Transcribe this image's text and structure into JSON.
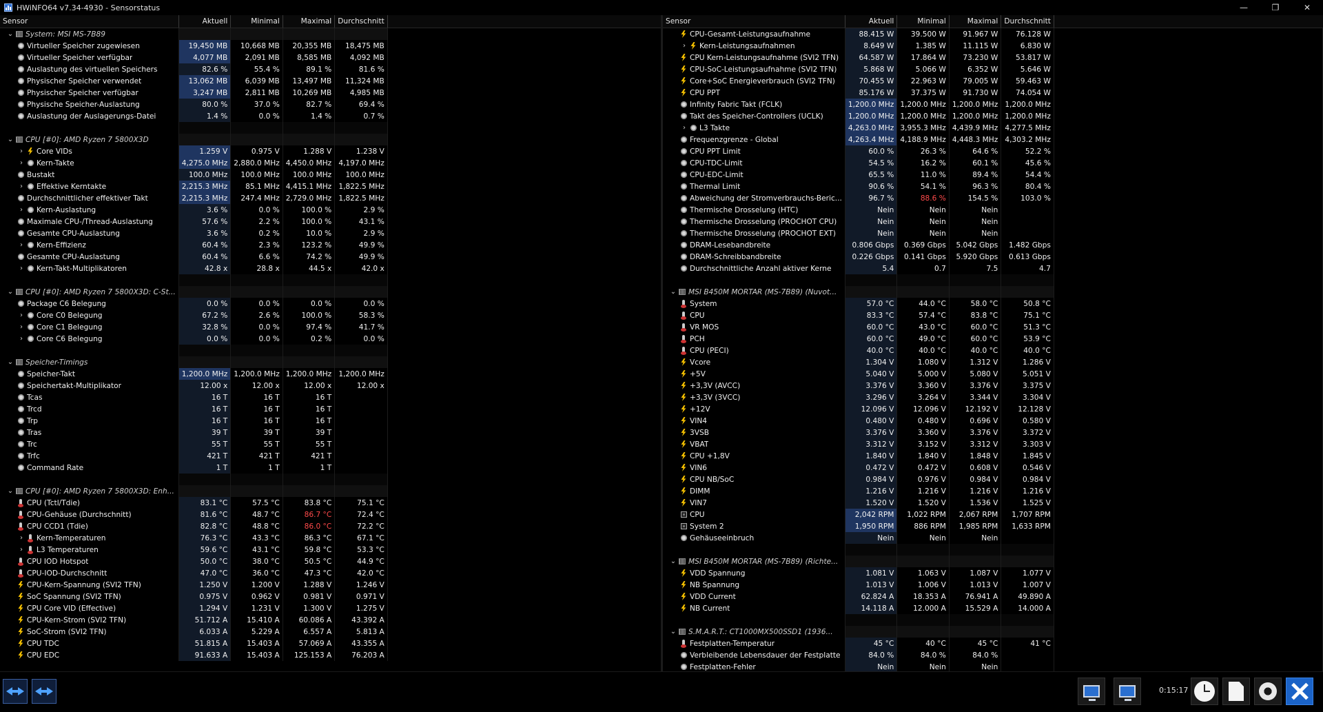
{
  "window": {
    "title": "HWiNFO64 v7.34-4930 - Sensorstatus",
    "controls": [
      "—",
      "❐",
      "✕"
    ]
  },
  "columns": {
    "sensor": "Sensor",
    "current": "Aktuell",
    "min": "Minimal",
    "max": "Maximal",
    "avg": "Durchschnitt"
  },
  "left": [
    {
      "t": "g",
      "n": "System: MSI MS-7B89"
    },
    {
      "t": "r",
      "i": "clock",
      "l": 1,
      "n": "Virtueller Speicher zugewiesen",
      "c": "19,450 MB",
      "mi": "10,668 MB",
      "ma": "20,355 MB",
      "av": "18,475 MB",
      "h": 1
    },
    {
      "t": "r",
      "i": "clock",
      "l": 1,
      "n": "Virtueller Speicher verfügbar",
      "c": "4,077 MB",
      "mi": "2,091 MB",
      "ma": "8,585 MB",
      "av": "4,092 MB",
      "h": 1
    },
    {
      "t": "r",
      "i": "clock",
      "l": 1,
      "n": "Auslastung des virtuellen Speichers",
      "c": "82.6 %",
      "mi": "55.4 %",
      "ma": "89.1 %",
      "av": "81.6 %"
    },
    {
      "t": "r",
      "i": "clock",
      "l": 1,
      "n": "Physischer Speicher verwendet",
      "c": "13,062 MB",
      "mi": "6,039 MB",
      "ma": "13,497 MB",
      "av": "11,324 MB",
      "h": 1
    },
    {
      "t": "r",
      "i": "clock",
      "l": 1,
      "n": "Physischer Speicher verfügbar",
      "c": "3,247 MB",
      "mi": "2,811 MB",
      "ma": "10,269 MB",
      "av": "4,985 MB",
      "h": 1
    },
    {
      "t": "r",
      "i": "clock",
      "l": 1,
      "n": "Physische Speicher-Auslastung",
      "c": "80.0 %",
      "mi": "37.0 %",
      "ma": "82.7 %",
      "av": "69.4 %"
    },
    {
      "t": "r",
      "i": "clock",
      "l": 1,
      "n": "Auslastung der Auslagerungs-Datei",
      "c": "1.4 %",
      "mi": "0.0 %",
      "ma": "1.4 %",
      "av": "0.7 %"
    },
    {
      "t": "s"
    },
    {
      "t": "g",
      "n": "CPU [#0]: AMD Ryzen 7 5800X3D"
    },
    {
      "t": "r",
      "i": "bolt",
      "l": 2,
      "x": 1,
      "n": "Core VIDs",
      "c": "1.259 V",
      "mi": "0.975 V",
      "ma": "1.288 V",
      "av": "1.238 V",
      "h": 1
    },
    {
      "t": "r",
      "i": "clock",
      "l": 2,
      "x": 1,
      "n": "Kern-Takte",
      "c": "4,275.0 MHz",
      "mi": "2,880.0 MHz",
      "ma": "4,450.0 MHz",
      "av": "4,197.0 MHz",
      "h": 1
    },
    {
      "t": "r",
      "i": "clock",
      "l": 1,
      "n": "Bustakt",
      "c": "100.0 MHz",
      "mi": "100.0 MHz",
      "ma": "100.0 MHz",
      "av": "100.0 MHz"
    },
    {
      "t": "r",
      "i": "clock",
      "l": 2,
      "x": 1,
      "n": "Effektive Kerntakte",
      "c": "2,215.3 MHz",
      "mi": "85.1 MHz",
      "ma": "4,415.1 MHz",
      "av": "1,822.5 MHz",
      "h": 1
    },
    {
      "t": "r",
      "i": "clock",
      "l": 1,
      "n": "Durchschnittlicher effektiver Takt",
      "c": "2,215.3 MHz",
      "mi": "247.4 MHz",
      "ma": "2,729.0 MHz",
      "av": "1,822.5 MHz",
      "h": 1
    },
    {
      "t": "r",
      "i": "clock",
      "l": 2,
      "x": 1,
      "n": "Kern-Auslastung",
      "c": "3.6 %",
      "mi": "0.0 %",
      "ma": "100.0 %",
      "av": "2.9 %"
    },
    {
      "t": "r",
      "i": "clock",
      "l": 1,
      "n": "Maximale CPU-/Thread-Auslastung",
      "c": "57.6 %",
      "mi": "2.2 %",
      "ma": "100.0 %",
      "av": "43.1 %"
    },
    {
      "t": "r",
      "i": "clock",
      "l": 1,
      "n": "Gesamte CPU-Auslastung",
      "c": "3.6 %",
      "mi": "0.2 %",
      "ma": "10.0 %",
      "av": "2.9 %"
    },
    {
      "t": "r",
      "i": "clock",
      "l": 2,
      "x": 1,
      "n": "Kern-Effizienz",
      "c": "60.4 %",
      "mi": "2.3 %",
      "ma": "123.2 %",
      "av": "49.9 %"
    },
    {
      "t": "r",
      "i": "clock",
      "l": 1,
      "n": "Gesamte CPU-Auslastung",
      "c": "60.4 %",
      "mi": "6.6 %",
      "ma": "74.2 %",
      "av": "49.9 %"
    },
    {
      "t": "r",
      "i": "clock",
      "l": 2,
      "x": 1,
      "n": "Kern-Takt-Multiplikatoren",
      "c": "42.8 x",
      "mi": "28.8 x",
      "ma": "44.5 x",
      "av": "42.0 x"
    },
    {
      "t": "s"
    },
    {
      "t": "g",
      "n": "CPU [#0]: AMD Ryzen 7 5800X3D: C-St..."
    },
    {
      "t": "r",
      "i": "clock",
      "l": 1,
      "n": "Package C6 Belegung",
      "c": "0.0 %",
      "mi": "0.0 %",
      "ma": "0.0 %",
      "av": "0.0 %"
    },
    {
      "t": "r",
      "i": "clock",
      "l": 2,
      "x": 1,
      "n": "Core C0 Belegung",
      "c": "67.2 %",
      "mi": "2.6 %",
      "ma": "100.0 %",
      "av": "58.3 %"
    },
    {
      "t": "r",
      "i": "clock",
      "l": 2,
      "x": 1,
      "n": "Core C1 Belegung",
      "c": "32.8 %",
      "mi": "0.0 %",
      "ma": "97.4 %",
      "av": "41.7 %"
    },
    {
      "t": "r",
      "i": "clock",
      "l": 2,
      "x": 1,
      "n": "Core C6 Belegung",
      "c": "0.0 %",
      "mi": "0.0 %",
      "ma": "0.2 %",
      "av": "0.0 %"
    },
    {
      "t": "s"
    },
    {
      "t": "g",
      "n": "Speicher-Timings"
    },
    {
      "t": "r",
      "i": "clock",
      "l": 1,
      "n": "Speicher-Takt",
      "c": "1,200.0 MHz",
      "mi": "1,200.0 MHz",
      "ma": "1,200.0 MHz",
      "av": "1,200.0 MHz",
      "h": 1
    },
    {
      "t": "r",
      "i": "clock",
      "l": 1,
      "n": "Speichertakt-Multiplikator",
      "c": "12.00 x",
      "mi": "12.00 x",
      "ma": "12.00 x",
      "av": "12.00 x"
    },
    {
      "t": "r",
      "i": "clock",
      "l": 1,
      "n": "Tcas",
      "c": "16 T",
      "mi": "16 T",
      "ma": "16 T",
      "av": ""
    },
    {
      "t": "r",
      "i": "clock",
      "l": 1,
      "n": "Trcd",
      "c": "16 T",
      "mi": "16 T",
      "ma": "16 T",
      "av": ""
    },
    {
      "t": "r",
      "i": "clock",
      "l": 1,
      "n": "Trp",
      "c": "16 T",
      "mi": "16 T",
      "ma": "16 T",
      "av": ""
    },
    {
      "t": "r",
      "i": "clock",
      "l": 1,
      "n": "Tras",
      "c": "39 T",
      "mi": "39 T",
      "ma": "39 T",
      "av": ""
    },
    {
      "t": "r",
      "i": "clock",
      "l": 1,
      "n": "Trc",
      "c": "55 T",
      "mi": "55 T",
      "ma": "55 T",
      "av": ""
    },
    {
      "t": "r",
      "i": "clock",
      "l": 1,
      "n": "Trfc",
      "c": "421 T",
      "mi": "421 T",
      "ma": "421 T",
      "av": ""
    },
    {
      "t": "r",
      "i": "clock",
      "l": 1,
      "n": "Command Rate",
      "c": "1 T",
      "mi": "1 T",
      "ma": "1 T",
      "av": ""
    },
    {
      "t": "s"
    },
    {
      "t": "g",
      "n": "CPU [#0]: AMD Ryzen 7 5800X3D: Enh..."
    },
    {
      "t": "r",
      "i": "therm",
      "l": 1,
      "n": "CPU (Tctl/Tdie)",
      "c": "83.1 °C",
      "mi": "57.5 °C",
      "ma": "83.8 °C",
      "av": "75.1 °C"
    },
    {
      "t": "r",
      "i": "therm",
      "l": 1,
      "n": "CPU-Gehäuse (Durchschnitt)",
      "c": "81.6 °C",
      "mi": "48.7 °C",
      "ma": "86.7 °C",
      "av": "72.4 °C",
      "rm": 1
    },
    {
      "t": "r",
      "i": "therm",
      "l": 1,
      "n": "CPU CCD1 (Tdie)",
      "c": "82.8 °C",
      "mi": "48.8 °C",
      "ma": "86.0 °C",
      "av": "72.2 °C",
      "rm": 1
    },
    {
      "t": "r",
      "i": "therm",
      "l": 2,
      "x": 1,
      "n": "Kern-Temperaturen",
      "c": "76.3 °C",
      "mi": "43.3 °C",
      "ma": "86.3 °C",
      "av": "67.1 °C"
    },
    {
      "t": "r",
      "i": "therm",
      "l": 2,
      "x": 1,
      "n": "L3 Temperaturen",
      "c": "59.6 °C",
      "mi": "43.1 °C",
      "ma": "59.8 °C",
      "av": "53.3 °C"
    },
    {
      "t": "r",
      "i": "therm",
      "l": 1,
      "n": "CPU IOD Hotspot",
      "c": "50.0 °C",
      "mi": "38.0 °C",
      "ma": "50.5 °C",
      "av": "44.9 °C"
    },
    {
      "t": "r",
      "i": "therm",
      "l": 1,
      "n": "CPU-IOD-Durchschnitt",
      "c": "47.0 °C",
      "mi": "36.0 °C",
      "ma": "47.3 °C",
      "av": "42.0 °C"
    },
    {
      "t": "r",
      "i": "bolt",
      "l": 1,
      "n": "CPU-Kern-Spannung (SVI2 TFN)",
      "c": "1.250 V",
      "mi": "1.200 V",
      "ma": "1.288 V",
      "av": "1.246 V"
    },
    {
      "t": "r",
      "i": "bolt",
      "l": 1,
      "n": "SoC Spannung (SVI2 TFN)",
      "c": "0.975 V",
      "mi": "0.962 V",
      "ma": "0.981 V",
      "av": "0.971 V"
    },
    {
      "t": "r",
      "i": "bolt",
      "l": 1,
      "n": "CPU Core VID (Effective)",
      "c": "1.294 V",
      "mi": "1.231 V",
      "ma": "1.300 V",
      "av": "1.275 V"
    },
    {
      "t": "r",
      "i": "bolt",
      "l": 1,
      "n": "CPU-Kern-Strom (SVI2 TFN)",
      "c": "51.712 A",
      "mi": "15.410 A",
      "ma": "60.086 A",
      "av": "43.392 A"
    },
    {
      "t": "r",
      "i": "bolt",
      "l": 1,
      "n": "SoC-Strom (SVI2 TFN)",
      "c": "6.033 A",
      "mi": "5.229 A",
      "ma": "6.557 A",
      "av": "5.813 A"
    },
    {
      "t": "r",
      "i": "bolt",
      "l": 1,
      "n": "CPU TDC",
      "c": "51.815 A",
      "mi": "15.403 A",
      "ma": "57.069 A",
      "av": "43.355 A"
    },
    {
      "t": "r",
      "i": "bolt",
      "l": 1,
      "n": "CPU EDC",
      "c": "91.633 A",
      "mi": "15.403 A",
      "ma": "125.153 A",
      "av": "76.203 A"
    }
  ],
  "right": [
    {
      "t": "r",
      "i": "bolt",
      "l": 1,
      "n": "CPU-Gesamt-Leistungsaufnahme",
      "c": "88.415 W",
      "mi": "39.500 W",
      "ma": "91.967 W",
      "av": "76.128 W"
    },
    {
      "t": "r",
      "i": "bolt",
      "l": 2,
      "x": 1,
      "n": "Kern-Leistungsaufnahmen",
      "c": "8.649 W",
      "mi": "1.385 W",
      "ma": "11.115 W",
      "av": "6.830 W"
    },
    {
      "t": "r",
      "i": "bolt",
      "l": 1,
      "n": "CPU Kern-Leistungsaufnahme (SVI2 TFN)",
      "c": "64.587 W",
      "mi": "17.864 W",
      "ma": "73.230 W",
      "av": "53.817 W"
    },
    {
      "t": "r",
      "i": "bolt",
      "l": 1,
      "n": "CPU-SoC-Leistungsaufnahme (SVI2 TFN)",
      "c": "5.868 W",
      "mi": "5.066 W",
      "ma": "6.352 W",
      "av": "5.646 W"
    },
    {
      "t": "r",
      "i": "bolt",
      "l": 1,
      "n": "Core+SoC Energieverbrauch (SVI2 TFN)",
      "c": "70.455 W",
      "mi": "22.963 W",
      "ma": "79.005 W",
      "av": "59.463 W"
    },
    {
      "t": "r",
      "i": "bolt",
      "l": 1,
      "n": "CPU PPT",
      "c": "85.176 W",
      "mi": "37.375 W",
      "ma": "91.730 W",
      "av": "74.054 W"
    },
    {
      "t": "r",
      "i": "clock",
      "l": 1,
      "n": "Infinity Fabric Takt (FCLK)",
      "c": "1,200.0 MHz",
      "mi": "1,200.0 MHz",
      "ma": "1,200.0 MHz",
      "av": "1,200.0 MHz",
      "h": 1
    },
    {
      "t": "r",
      "i": "clock",
      "l": 1,
      "n": "Takt des Speicher-Controllers (UCLK)",
      "c": "1,200.0 MHz",
      "mi": "1,200.0 MHz",
      "ma": "1,200.0 MHz",
      "av": "1,200.0 MHz",
      "h": 1
    },
    {
      "t": "r",
      "i": "clock",
      "l": 2,
      "x": 1,
      "n": "L3 Takte",
      "c": "4,263.0 MHz",
      "mi": "3,955.3 MHz",
      "ma": "4,439.9 MHz",
      "av": "4,277.5 MHz",
      "h": 1
    },
    {
      "t": "r",
      "i": "clock",
      "l": 1,
      "n": "Frequenzgrenze - Global",
      "c": "4,263.4 MHz",
      "mi": "4,188.9 MHz",
      "ma": "4,448.3 MHz",
      "av": "4,303.2 MHz",
      "h": 1
    },
    {
      "t": "r",
      "i": "clock",
      "l": 1,
      "n": "CPU PPT Limit",
      "c": "60.0 %",
      "mi": "26.3 %",
      "ma": "64.6 %",
      "av": "52.2 %"
    },
    {
      "t": "r",
      "i": "clock",
      "l": 1,
      "n": "CPU-TDC-Limit",
      "c": "54.5 %",
      "mi": "16.2 %",
      "ma": "60.1 %",
      "av": "45.6 %"
    },
    {
      "t": "r",
      "i": "clock",
      "l": 1,
      "n": "CPU-EDC-Limit",
      "c": "65.5 %",
      "mi": "11.0 %",
      "ma": "89.4 %",
      "av": "54.4 %"
    },
    {
      "t": "r",
      "i": "clock",
      "l": 1,
      "n": "Thermal Limit",
      "c": "90.6 %",
      "mi": "54.1 %",
      "ma": "96.3 %",
      "av": "80.4 %"
    },
    {
      "t": "r",
      "i": "clock",
      "l": 1,
      "n": "Abweichung der Stromverbrauchs-Beric...",
      "c": "96.7 %",
      "mi": "88.6 %",
      "ma": "154.5 %",
      "av": "103.0 %",
      "rmi": 1
    },
    {
      "t": "r",
      "i": "clock",
      "l": 1,
      "n": "Thermische Drosselung (HTC)",
      "c": "Nein",
      "mi": "Nein",
      "ma": "Nein",
      "av": ""
    },
    {
      "t": "r",
      "i": "clock",
      "l": 1,
      "n": "Thermische Drosselung (PROCHOT CPU)",
      "c": "Nein",
      "mi": "Nein",
      "ma": "Nein",
      "av": ""
    },
    {
      "t": "r",
      "i": "clock",
      "l": 1,
      "n": "Thermische Drosselung (PROCHOT EXT)",
      "c": "Nein",
      "mi": "Nein",
      "ma": "Nein",
      "av": ""
    },
    {
      "t": "r",
      "i": "clock",
      "l": 1,
      "n": "DRAM-Lesebandbreite",
      "c": "0.806 Gbps",
      "mi": "0.369 Gbps",
      "ma": "5.042 Gbps",
      "av": "1.482 Gbps"
    },
    {
      "t": "r",
      "i": "clock",
      "l": 1,
      "n": "DRAM-Schreibbandbreite",
      "c": "0.226 Gbps",
      "mi": "0.141 Gbps",
      "ma": "5.920 Gbps",
      "av": "0.613 Gbps"
    },
    {
      "t": "r",
      "i": "clock",
      "l": 1,
      "n": "Durchschnittliche Anzahl aktiver Kerne",
      "c": "5.4",
      "mi": "0.7",
      "ma": "7.5",
      "av": "4.7"
    },
    {
      "t": "s"
    },
    {
      "t": "g",
      "n": "MSI B450M MORTAR (MS-7B89) (Nuvot..."
    },
    {
      "t": "r",
      "i": "therm",
      "l": 1,
      "n": "System",
      "c": "57.0 °C",
      "mi": "44.0 °C",
      "ma": "58.0 °C",
      "av": "50.8 °C"
    },
    {
      "t": "r",
      "i": "therm",
      "l": 1,
      "n": "CPU",
      "c": "83.3 °C",
      "mi": "57.4 °C",
      "ma": "83.8 °C",
      "av": "75.1 °C"
    },
    {
      "t": "r",
      "i": "therm",
      "l": 1,
      "n": "VR MOS",
      "c": "60.0 °C",
      "mi": "43.0 °C",
      "ma": "60.0 °C",
      "av": "51.3 °C"
    },
    {
      "t": "r",
      "i": "therm",
      "l": 1,
      "n": "PCH",
      "c": "60.0 °C",
      "mi": "49.0 °C",
      "ma": "60.0 °C",
      "av": "53.9 °C"
    },
    {
      "t": "r",
      "i": "therm",
      "l": 1,
      "n": "CPU (PECI)",
      "c": "40.0 °C",
      "mi": "40.0 °C",
      "ma": "40.0 °C",
      "av": "40.0 °C"
    },
    {
      "t": "r",
      "i": "bolt",
      "l": 1,
      "n": "Vcore",
      "c": "1.304 V",
      "mi": "1.080 V",
      "ma": "1.312 V",
      "av": "1.286 V"
    },
    {
      "t": "r",
      "i": "bolt",
      "l": 1,
      "n": "+5V",
      "c": "5.040 V",
      "mi": "5.000 V",
      "ma": "5.080 V",
      "av": "5.051 V"
    },
    {
      "t": "r",
      "i": "bolt",
      "l": 1,
      "n": "+3,3V (AVCC)",
      "c": "3.376 V",
      "mi": "3.360 V",
      "ma": "3.376 V",
      "av": "3.375 V"
    },
    {
      "t": "r",
      "i": "bolt",
      "l": 1,
      "n": "+3,3V (3VCC)",
      "c": "3.296 V",
      "mi": "3.264 V",
      "ma": "3.344 V",
      "av": "3.304 V"
    },
    {
      "t": "r",
      "i": "bolt",
      "l": 1,
      "n": "+12V",
      "c": "12.096 V",
      "mi": "12.096 V",
      "ma": "12.192 V",
      "av": "12.128 V"
    },
    {
      "t": "r",
      "i": "bolt",
      "l": 1,
      "n": "VIN4",
      "c": "0.480 V",
      "mi": "0.480 V",
      "ma": "0.696 V",
      "av": "0.580 V"
    },
    {
      "t": "r",
      "i": "bolt",
      "l": 1,
      "n": "3VSB",
      "c": "3.376 V",
      "mi": "3.360 V",
      "ma": "3.376 V",
      "av": "3.372 V"
    },
    {
      "t": "r",
      "i": "bolt",
      "l": 1,
      "n": "VBAT",
      "c": "3.312 V",
      "mi": "3.152 V",
      "ma": "3.312 V",
      "av": "3.303 V"
    },
    {
      "t": "r",
      "i": "bolt",
      "l": 1,
      "n": "CPU +1,8V",
      "c": "1.840 V",
      "mi": "1.840 V",
      "ma": "1.848 V",
      "av": "1.845 V"
    },
    {
      "t": "r",
      "i": "bolt",
      "l": 1,
      "n": "VIN6",
      "c": "0.472 V",
      "mi": "0.472 V",
      "ma": "0.608 V",
      "av": "0.546 V"
    },
    {
      "t": "r",
      "i": "bolt",
      "l": 1,
      "n": "CPU NB/SoC",
      "c": "0.984 V",
      "mi": "0.976 V",
      "ma": "0.984 V",
      "av": "0.984 V"
    },
    {
      "t": "r",
      "i": "bolt",
      "l": 1,
      "n": "DIMM",
      "c": "1.216 V",
      "mi": "1.216 V",
      "ma": "1.216 V",
      "av": "1.216 V"
    },
    {
      "t": "r",
      "i": "bolt",
      "l": 1,
      "n": "VIN7",
      "c": "1.520 V",
      "mi": "1.520 V",
      "ma": "1.536 V",
      "av": "1.525 V"
    },
    {
      "t": "r",
      "i": "fan",
      "l": 1,
      "n": "CPU",
      "c": "2,042 RPM",
      "mi": "1,022 RPM",
      "ma": "2,067 RPM",
      "av": "1,707 RPM",
      "h": 1
    },
    {
      "t": "r",
      "i": "fan",
      "l": 1,
      "n": "System 2",
      "c": "1,950 RPM",
      "mi": "886 RPM",
      "ma": "1,985 RPM",
      "av": "1,633 RPM",
      "h": 1
    },
    {
      "t": "r",
      "i": "clock",
      "l": 1,
      "n": "Gehäuseeinbruch",
      "c": "Nein",
      "mi": "Nein",
      "ma": "Nein",
      "av": ""
    },
    {
      "t": "s"
    },
    {
      "t": "g",
      "n": "MSI B450M MORTAR (MS-7B89) (Richte..."
    },
    {
      "t": "r",
      "i": "bolt",
      "l": 1,
      "n": "VDD Spannung",
      "c": "1.081 V",
      "mi": "1.063 V",
      "ma": "1.087 V",
      "av": "1.077 V"
    },
    {
      "t": "r",
      "i": "bolt",
      "l": 1,
      "n": "NB Spannung",
      "c": "1.013 V",
      "mi": "1.006 V",
      "ma": "1.013 V",
      "av": "1.007 V"
    },
    {
      "t": "r",
      "i": "bolt",
      "l": 1,
      "n": "VDD Current",
      "c": "62.824 A",
      "mi": "18.353 A",
      "ma": "76.941 A",
      "av": "49.890 A"
    },
    {
      "t": "r",
      "i": "bolt",
      "l": 1,
      "n": "NB Current",
      "c": "14.118 A",
      "mi": "12.000 A",
      "ma": "15.529 A",
      "av": "14.000 A"
    },
    {
      "t": "s"
    },
    {
      "t": "g",
      "n": "S.M.A.R.T.: CT1000MX500SSD1 (1936..."
    },
    {
      "t": "r",
      "i": "therm",
      "l": 1,
      "n": "Festplatten-Temperatur",
      "c": "45 °C",
      "mi": "40 °C",
      "ma": "45 °C",
      "av": "41 °C"
    },
    {
      "t": "r",
      "i": "clock",
      "l": 1,
      "n": "Verbleibende Lebensdauer der Festplatte",
      "c": "84.0 %",
      "mi": "84.0 %",
      "ma": "84.0 %",
      "av": ""
    },
    {
      "t": "r",
      "i": "clock",
      "l": 1,
      "n": "Festplatten-Fehler",
      "c": "Nein",
      "mi": "Nein",
      "ma": "Nein",
      "av": ""
    }
  ],
  "status": {
    "timer": "0:15:17"
  }
}
